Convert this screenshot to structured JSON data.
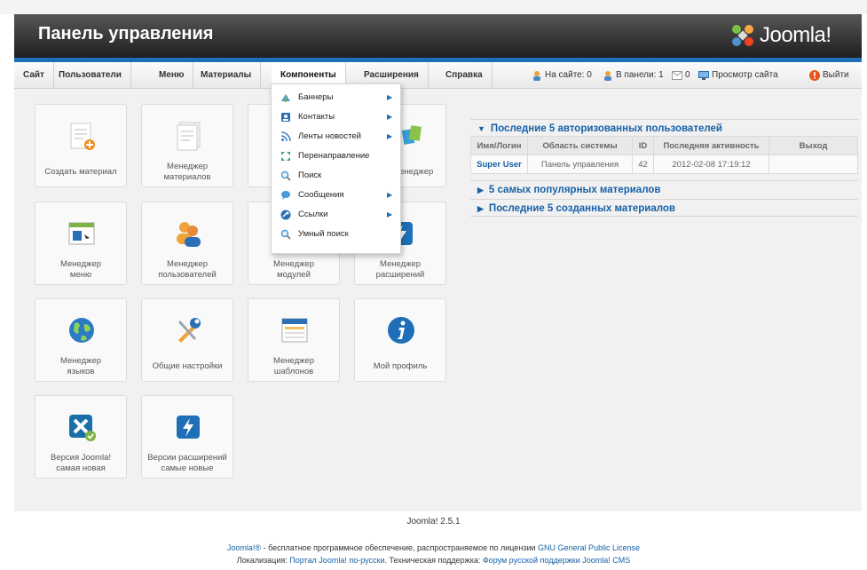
{
  "header": {
    "title": "Панель управления",
    "logo_text": "Joomla!"
  },
  "menu": {
    "site": "Сайт",
    "users": "Пользователи",
    "menus": "Меню",
    "content": "Материалы",
    "components": "Компоненты",
    "extensions": "Расширения",
    "help": "Справка"
  },
  "status": {
    "on_site": "На сайте: 0",
    "in_panel": "В панели: 1",
    "messages": "0",
    "view_site": "Просмотр сайта",
    "logout": "Выйти"
  },
  "tiles": {
    "create_article": "Создать материал",
    "article_manager": "Менеджер материалов",
    "media_manager_part": "менеджер",
    "menu_manager": "Менеджер меню",
    "user_manager": "Менеджер пользователей",
    "module_manager": "Менеджер модулей",
    "extension_manager": "Менеджер расширений",
    "language_manager": "Менеджер языков",
    "global_config": "Общие настройки",
    "template_manager": "Менеджер шаблонов",
    "my_profile": "Мой профиль",
    "joomla_version": "Версия Joomla! самая новая",
    "extensions_version": "Версии расширений самые новые"
  },
  "dropdown": [
    {
      "label": "Баннеры",
      "has_sub": "true"
    },
    {
      "label": "Контакты",
      "has_sub": "true"
    },
    {
      "label": "Ленты новостей",
      "has_sub": "true"
    },
    {
      "label": "Перенаправление",
      "has_sub": "false"
    },
    {
      "label": "Поиск",
      "has_sub": "false"
    },
    {
      "label": "Сообщения",
      "has_sub": "true"
    },
    {
      "label": "Ссылки",
      "has_sub": "true"
    },
    {
      "label": "Умный поиск",
      "has_sub": "false"
    }
  ],
  "panels": {
    "logged_title": "Последние 5 авторизованных пользователей",
    "columns": [
      "Имя/Логин",
      "Область системы",
      "ID",
      "Последняя активность",
      "Выход"
    ],
    "row": {
      "name": "Super User",
      "area": "Панель управления",
      "id": "42",
      "activity": "2012-02-08 17:19:12",
      "logout": ""
    },
    "popular_title": "5 самых популярных материалов",
    "recent_title": "Последние 5 созданных материалов"
  },
  "footer": {
    "version": "Joomla! 2.5.1",
    "line1_link1": "Joomla!®",
    "line1_text": " - бесплатное программное обеспечение, распространяемое по лицензии ",
    "line1_link2": "GNU General Public License",
    "line2_text1": "Локализация: ",
    "line2_link1": "Портал Joomla! по-русски",
    "line2_text2": ". Техническая поддержка: ",
    "line2_link2": "Форум русской поддержки Joomla! CMS"
  },
  "colors": {
    "accent": "#1e6fb7",
    "link": "#1761a8",
    "header_dark": "#1e1e1e"
  }
}
